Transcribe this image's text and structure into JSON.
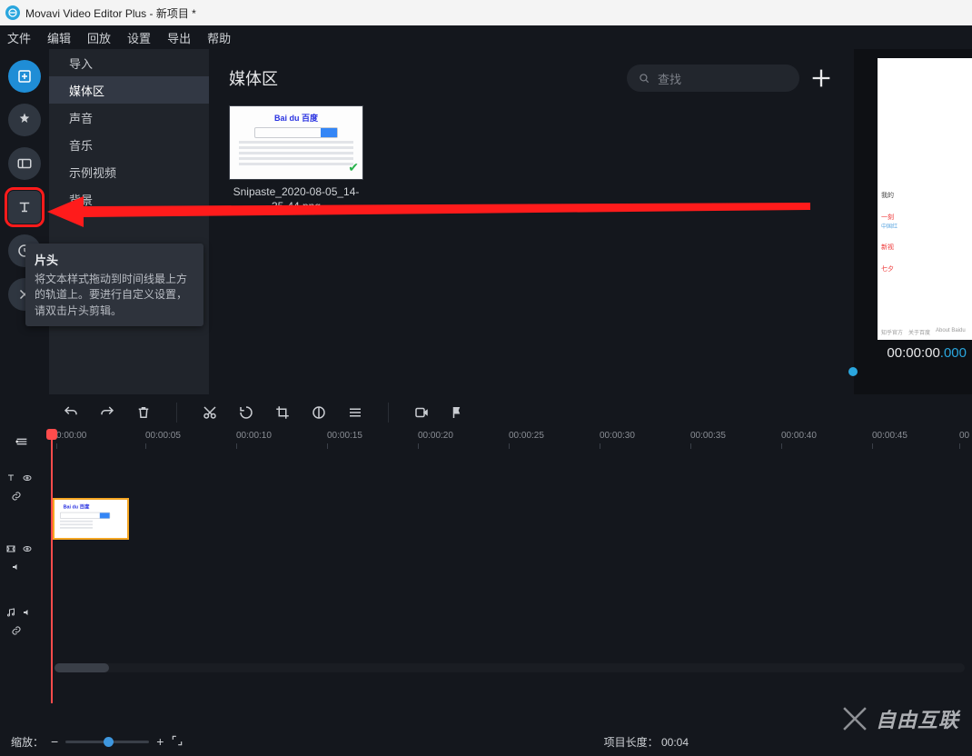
{
  "window_title": "Movavi Video Editor Plus - 新项目 *",
  "menu": [
    "文件",
    "编辑",
    "回放",
    "设置",
    "导出",
    "帮助"
  ],
  "side_tools": [
    {
      "name": "import-icon",
      "accent": true
    },
    {
      "name": "effects-icon"
    },
    {
      "name": "transitions-icon"
    },
    {
      "name": "titles-icon",
      "highlight": true
    },
    {
      "name": "stickers-icon"
    },
    {
      "name": "more-tools-icon"
    }
  ],
  "subnav": {
    "items": [
      {
        "label": "导入",
        "active": false
      },
      {
        "label": "媒体区",
        "active": true
      },
      {
        "label": "声音",
        "active": false
      },
      {
        "label": "音乐",
        "active": false
      },
      {
        "label": "示例视频",
        "active": false
      },
      {
        "label": "背景",
        "active": false
      }
    ]
  },
  "media": {
    "title": "媒体区",
    "search_placeholder": "查找",
    "clip_name": "Snipaste_2020-08-05_14-35-44.png"
  },
  "tooltip": {
    "title": "片头",
    "body": "将文本样式拖动到时间线最上方的轨道上。要进行自定义设置，请双击片头剪辑。"
  },
  "preview": {
    "time_main": "00:00:00",
    "time_ms": ".000",
    "sidebar_lines": [
      "我的",
      "一刻",
      "中国红",
      "新视",
      "七夕"
    ],
    "footer": [
      "知乎官方",
      "关于百度",
      "About Baidu"
    ]
  },
  "timeline": {
    "ticks": [
      "0:00:00",
      "00:00:05",
      "00:00:10",
      "00:00:15",
      "00:00:20",
      "00:00:25",
      "00:00:30",
      "00:00:35",
      "00:00:40",
      "00:00:45",
      "00"
    ]
  },
  "bottom": {
    "zoom_label": "缩放：",
    "project_len_label": "项目长度：",
    "project_len_value": "00:04"
  },
  "watermark": "自由互联"
}
